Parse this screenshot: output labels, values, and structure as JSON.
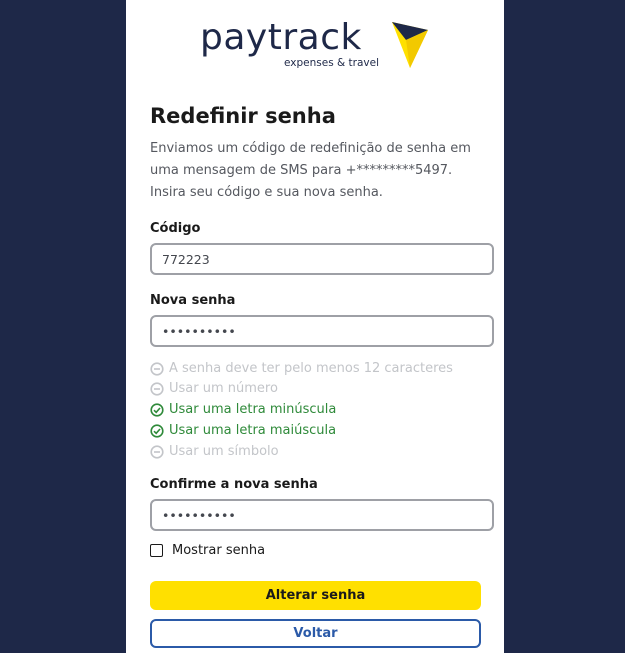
{
  "brand": {
    "name": "paytrack",
    "tagline": "expenses & travel",
    "colors": {
      "navy": "#1e2848",
      "yellow": "#ffe000",
      "blue": "#2b5aa8",
      "success": "#2f8a3a"
    }
  },
  "form": {
    "title": "Redefinir senha",
    "description": "Enviamos um código de redefinição de senha em uma mensagem de SMS para +*********5497. Insira seu código e sua nova senha.",
    "code": {
      "label": "Código",
      "value": "772223"
    },
    "new_password": {
      "label": "Nova senha",
      "value": "••••••••••"
    },
    "rules": [
      {
        "text": "A senha deve ter pelo menos 12 caracteres",
        "met": false,
        "icon": "minus-circle-icon"
      },
      {
        "text": "Usar um número",
        "met": false,
        "icon": "minus-circle-icon"
      },
      {
        "text": "Usar uma letra minúscula",
        "met": true,
        "icon": "check-circle-icon"
      },
      {
        "text": "Usar uma letra maiúscula",
        "met": true,
        "icon": "check-circle-icon"
      },
      {
        "text": "Usar um símbolo",
        "met": false,
        "icon": "minus-circle-icon"
      }
    ],
    "confirm_password": {
      "label": "Confirme a nova senha",
      "value": "••••••••••"
    },
    "show_password": {
      "label": "Mostrar senha",
      "checked": false
    },
    "submit_label": "Alterar senha",
    "back_label": "Voltar"
  }
}
